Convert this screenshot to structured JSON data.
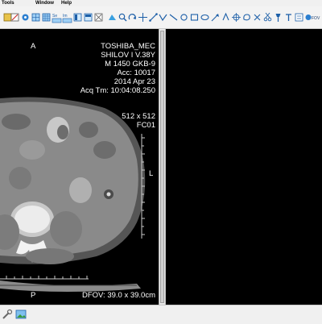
{
  "menu": {
    "tools": "Tools",
    "window": "Window",
    "help": "Help"
  },
  "toolbar": {
    "buttons": [
      "open-icon",
      "save-icon",
      "settings-icon",
      "layout-1x1-icon",
      "layout-grid-icon",
      "layout-1x2-icon",
      "layout-2x1-icon",
      "compare-icon",
      "flip-icon",
      "rotate-icon",
      "play-icon",
      "undo-icon",
      "ruler-icon",
      "angle-icon",
      "circle-icon",
      "ellipse-icon",
      "rectangle-icon",
      "text-icon",
      "arrow-icon",
      "crosshair-icon",
      "roi-icon"
    ],
    "labels": {
      "se": "Se",
      "im": "Im"
    }
  },
  "viewer": {
    "orientation_top": "A",
    "orientation_bottom": "P",
    "orientation_left": "R",
    "orientation_right": "L",
    "institution": "TOSHIBA_MEC",
    "patient": "SHILOV I V.38Y",
    "patient_info": "M  1450   GKB-9",
    "accession": "Acc: 10017",
    "study_date": "2014 Apr 23",
    "acq_time": "Acq Tm: 10:04:08.250",
    "matrix": "512 x 512",
    "kernel": "FC01",
    "dfov": "DFOV: 39.0 x 39.0cm"
  },
  "colors": {
    "background": "#000000",
    "overlay_text": "#ffffff",
    "chrome": "#f0f0f0"
  }
}
